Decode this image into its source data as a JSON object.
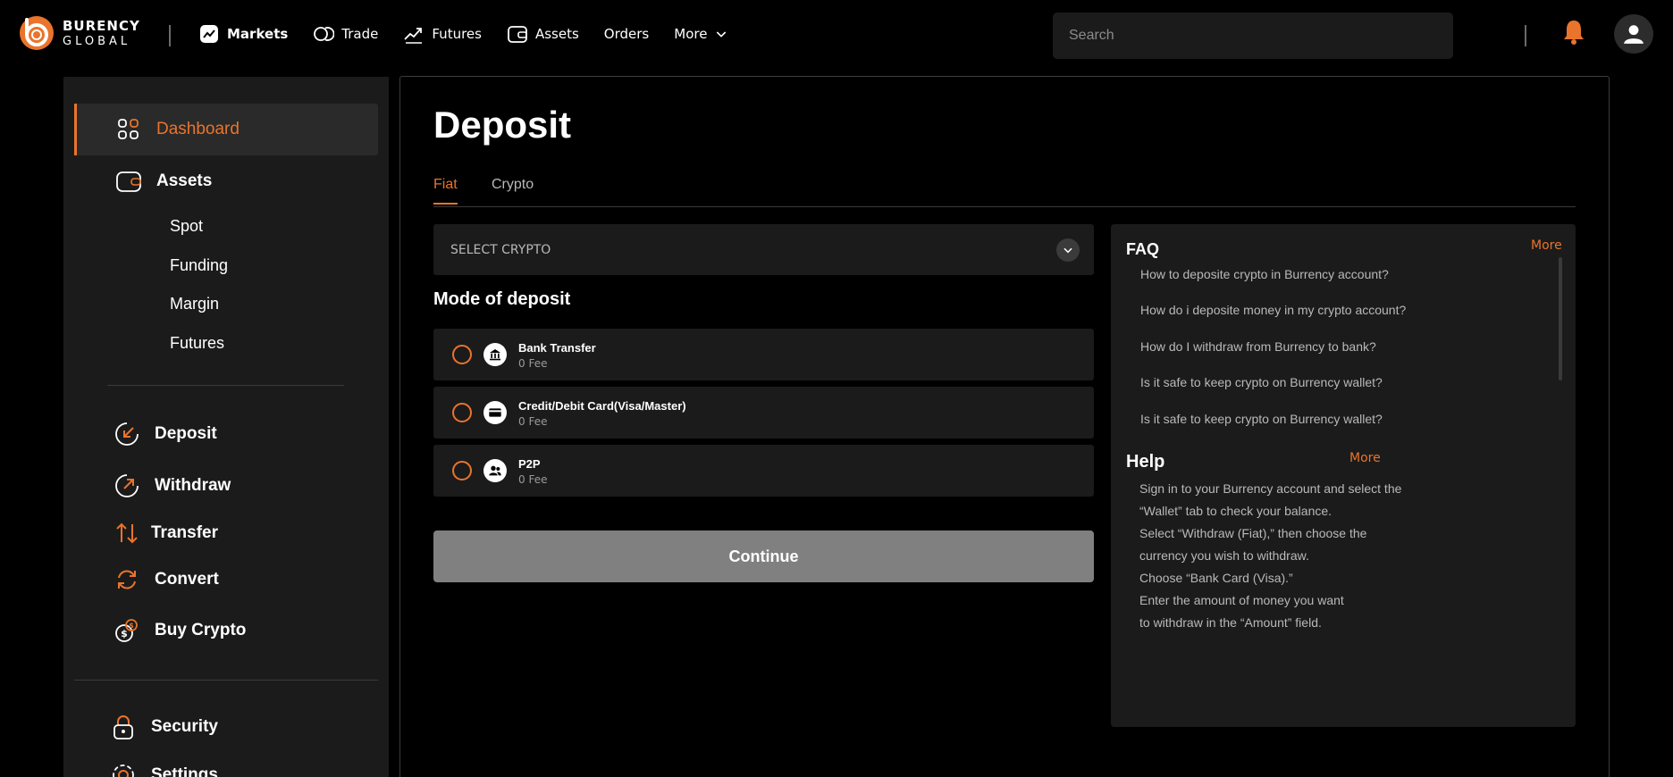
{
  "brand": {
    "line1": "BURENCY",
    "line2": "GLOBAL",
    "accent": "#e9742b"
  },
  "nav": {
    "items": [
      {
        "label": "Markets",
        "icon": "chart-icon"
      },
      {
        "label": "Trade",
        "icon": "coins-icon"
      },
      {
        "label": "Futures",
        "icon": "futures-icon"
      },
      {
        "label": "Assets",
        "icon": "wallet-icon"
      },
      {
        "label": "Orders",
        "icon": ""
      },
      {
        "label": "More",
        "icon": "chevron-down-icon"
      }
    ]
  },
  "search": {
    "placeholder": "Search"
  },
  "sidebar": {
    "dashboard": "Dashboard",
    "assets": "Assets",
    "sub_items": [
      "Spot",
      "Funding",
      "Margin",
      "Futures"
    ],
    "deposit": "Deposit",
    "withdraw": "Withdraw",
    "transfer": "Transfer",
    "convert": "Convert",
    "buy_crypto": "Buy Crypto",
    "security": "Security",
    "settings": "Settings"
  },
  "main": {
    "title": "Deposit",
    "tabs": [
      "Fiat",
      "Crypto"
    ],
    "select_placeholder": "SELECT CRYPTO",
    "mode_title": "Mode of deposit",
    "modes": [
      {
        "name": "Bank Transfer",
        "fee": "0 Fee"
      },
      {
        "name": "Credit/Debit Card(Visa/Master)",
        "fee": "0 Fee"
      },
      {
        "name": "P2P",
        "fee": "0 Fee"
      }
    ],
    "continue": "Continue"
  },
  "faq": {
    "title": "FAQ",
    "more": "More",
    "questions": [
      "How to deposite crypto in Burrency account?",
      "How do i deposite money in my crypto account?",
      "How do I withdraw from Burrency to bank?",
      "Is it safe to keep crypto on Burrency wallet?",
      "Is it safe to keep crypto on Burrency wallet?"
    ]
  },
  "help": {
    "title": "Help",
    "more": "More",
    "lines": [
      "Sign in to your Burrency account and select the",
      "“Wallet” tab to check your balance.",
      "Select “Withdraw (Fiat),” then choose the",
      "currency you wish to withdraw.",
      "Choose “Bank Card (Visa).”",
      "Enter the amount of money you want",
      "to withdraw in the “Amount” field."
    ]
  }
}
